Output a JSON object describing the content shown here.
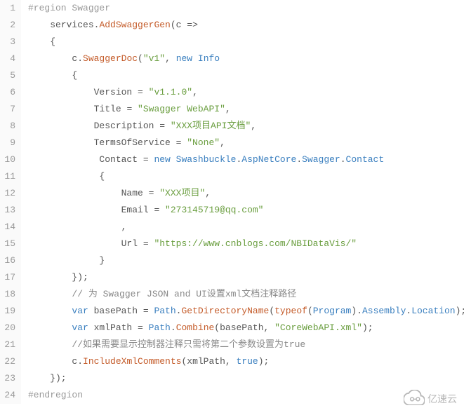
{
  "lines": [
    {
      "n": 1,
      "tokens": [
        {
          "c": "preproc",
          "t": "#region Swagger"
        }
      ]
    },
    {
      "n": 2,
      "tokens": [
        {
          "c": "ident",
          "t": "    services"
        },
        {
          "c": "punc",
          "t": "."
        },
        {
          "c": "method",
          "t": "AddSwaggerGen"
        },
        {
          "c": "punc",
          "t": "(c "
        },
        {
          "c": "punc",
          "t": "=>"
        }
      ]
    },
    {
      "n": 3,
      "tokens": [
        {
          "c": "punc",
          "t": "    {"
        }
      ]
    },
    {
      "n": 4,
      "tokens": [
        {
          "c": "ident",
          "t": "        c"
        },
        {
          "c": "punc",
          "t": "."
        },
        {
          "c": "method",
          "t": "SwaggerDoc"
        },
        {
          "c": "punc",
          "t": "("
        },
        {
          "c": "string",
          "t": "\"v1\""
        },
        {
          "c": "punc",
          "t": ", "
        },
        {
          "c": "keyword",
          "t": "new"
        },
        {
          "c": "punc",
          "t": " "
        },
        {
          "c": "type",
          "t": "Info"
        }
      ]
    },
    {
      "n": 5,
      "tokens": [
        {
          "c": "punc",
          "t": "        {"
        }
      ]
    },
    {
      "n": 6,
      "tokens": [
        {
          "c": "ident",
          "t": "            Version "
        },
        {
          "c": "punc",
          "t": "= "
        },
        {
          "c": "string",
          "t": "\"v1.1.0\""
        },
        {
          "c": "punc",
          "t": ","
        }
      ]
    },
    {
      "n": 7,
      "tokens": [
        {
          "c": "ident",
          "t": "            Title "
        },
        {
          "c": "punc",
          "t": "= "
        },
        {
          "c": "string",
          "t": "\"Swagger WebAPI\""
        },
        {
          "c": "punc",
          "t": ","
        }
      ]
    },
    {
      "n": 8,
      "tokens": [
        {
          "c": "ident",
          "t": "            Description "
        },
        {
          "c": "punc",
          "t": "= "
        },
        {
          "c": "string",
          "t": "\"XXX项目API文档\""
        },
        {
          "c": "punc",
          "t": ","
        }
      ]
    },
    {
      "n": 9,
      "tokens": [
        {
          "c": "ident",
          "t": "            TermsOfService "
        },
        {
          "c": "punc",
          "t": "= "
        },
        {
          "c": "string",
          "t": "\"None\""
        },
        {
          "c": "punc",
          "t": ","
        }
      ]
    },
    {
      "n": 10,
      "tokens": [
        {
          "c": "ident",
          "t": "             Contact "
        },
        {
          "c": "punc",
          "t": "= "
        },
        {
          "c": "keyword",
          "t": "new"
        },
        {
          "c": "punc",
          "t": " "
        },
        {
          "c": "type",
          "t": "Swashbuckle"
        },
        {
          "c": "punc",
          "t": "."
        },
        {
          "c": "type",
          "t": "AspNetCore"
        },
        {
          "c": "punc",
          "t": "."
        },
        {
          "c": "type",
          "t": "Swagger"
        },
        {
          "c": "punc",
          "t": "."
        },
        {
          "c": "type",
          "t": "Contact"
        }
      ]
    },
    {
      "n": 11,
      "tokens": [
        {
          "c": "punc",
          "t": "             {"
        }
      ]
    },
    {
      "n": 12,
      "tokens": [
        {
          "c": "ident",
          "t": "                 Name "
        },
        {
          "c": "punc",
          "t": "= "
        },
        {
          "c": "string",
          "t": "\"XXX项目\""
        },
        {
          "c": "punc",
          "t": ","
        }
      ]
    },
    {
      "n": 13,
      "tokens": [
        {
          "c": "ident",
          "t": "                 Email "
        },
        {
          "c": "punc",
          "t": "= "
        },
        {
          "c": "string",
          "t": "\"273145719@qq.com\""
        }
      ]
    },
    {
      "n": 14,
      "tokens": [
        {
          "c": "punc",
          "t": "                 ,"
        }
      ]
    },
    {
      "n": 15,
      "tokens": [
        {
          "c": "ident",
          "t": "                 Url "
        },
        {
          "c": "punc",
          "t": "= "
        },
        {
          "c": "string",
          "t": "\"https://www.cnblogs.com/NBIDataVis/\""
        }
      ]
    },
    {
      "n": 16,
      "tokens": [
        {
          "c": "punc",
          "t": "             }"
        }
      ]
    },
    {
      "n": 17,
      "tokens": [
        {
          "c": "punc",
          "t": "        });"
        }
      ]
    },
    {
      "n": 18,
      "tokens": [
        {
          "c": "comment",
          "t": "        // 为 Swagger JSON and UI设置xml文档注释路径"
        }
      ]
    },
    {
      "n": 19,
      "tokens": [
        {
          "c": "punc",
          "t": "        "
        },
        {
          "c": "keyword",
          "t": "var"
        },
        {
          "c": "ident",
          "t": " basePath "
        },
        {
          "c": "punc",
          "t": "= "
        },
        {
          "c": "type",
          "t": "Path"
        },
        {
          "c": "punc",
          "t": "."
        },
        {
          "c": "method",
          "t": "GetDirectoryName"
        },
        {
          "c": "punc",
          "t": "("
        },
        {
          "c": "typeof",
          "t": "typeof"
        },
        {
          "c": "punc",
          "t": "("
        },
        {
          "c": "type",
          "t": "Program"
        },
        {
          "c": "punc",
          "t": ")."
        },
        {
          "c": "type",
          "t": "Assembly"
        },
        {
          "c": "punc",
          "t": "."
        },
        {
          "c": "type",
          "t": "Location"
        },
        {
          "c": "punc",
          "t": ");"
        }
      ]
    },
    {
      "n": 20,
      "tokens": [
        {
          "c": "punc",
          "t": "        "
        },
        {
          "c": "keyword",
          "t": "var"
        },
        {
          "c": "ident",
          "t": " xmlPath "
        },
        {
          "c": "punc",
          "t": "= "
        },
        {
          "c": "type",
          "t": "Path"
        },
        {
          "c": "punc",
          "t": "."
        },
        {
          "c": "method",
          "t": "Combine"
        },
        {
          "c": "punc",
          "t": "(basePath, "
        },
        {
          "c": "string",
          "t": "\"CoreWebAPI.xml\""
        },
        {
          "c": "punc",
          "t": ");"
        }
      ]
    },
    {
      "n": 21,
      "tokens": [
        {
          "c": "comment",
          "t": "        //如果需要显示控制器注释只需将第二个参数设置为true"
        }
      ]
    },
    {
      "n": 22,
      "tokens": [
        {
          "c": "ident",
          "t": "        c"
        },
        {
          "c": "punc",
          "t": "."
        },
        {
          "c": "method",
          "t": "IncludeXmlComments"
        },
        {
          "c": "punc",
          "t": "(xmlPath, "
        },
        {
          "c": "keyword",
          "t": "true"
        },
        {
          "c": "punc",
          "t": ");"
        }
      ]
    },
    {
      "n": 23,
      "tokens": [
        {
          "c": "punc",
          "t": "    });"
        }
      ]
    },
    {
      "n": 24,
      "tokens": [
        {
          "c": "preproc",
          "t": "#endregion"
        }
      ]
    }
  ],
  "watermark_text": "亿速云"
}
